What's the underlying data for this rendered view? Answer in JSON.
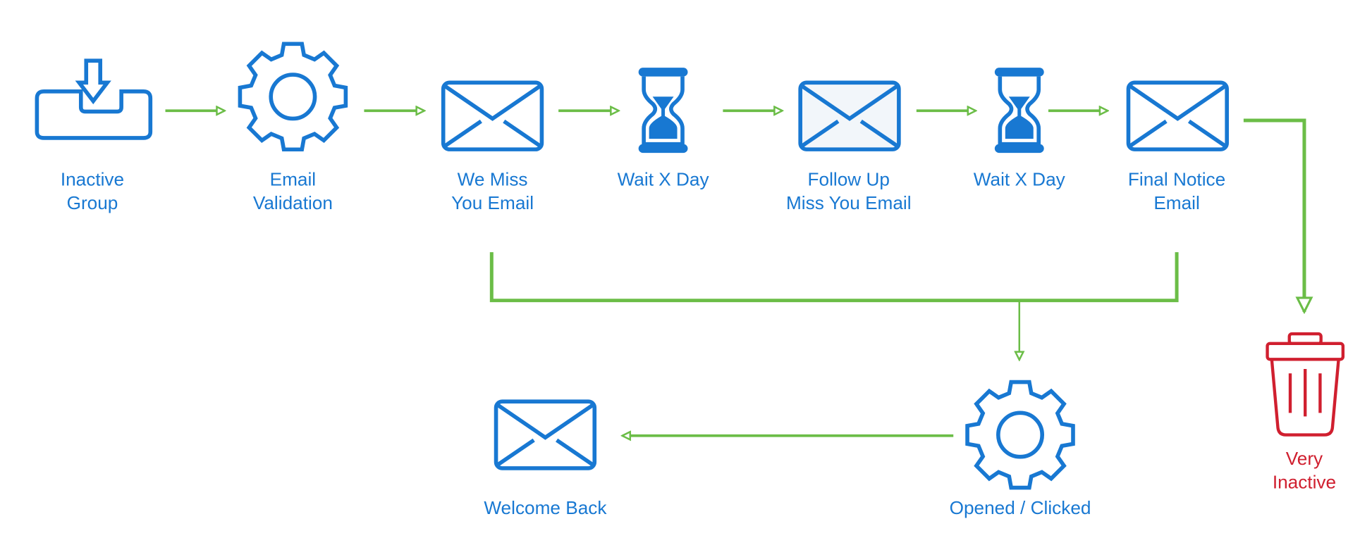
{
  "colors": {
    "icon": "#1878d2",
    "connector": "#6bbd47",
    "danger": "#d01f2f",
    "envelope_fill_highlight": "#f2f6fa"
  },
  "nodes": {
    "inactive_group": {
      "label_1": "Inactive",
      "label_2": "Group",
      "icon": "inbox-download-icon"
    },
    "email_validation": {
      "label_1": "Email",
      "label_2": "Validation",
      "icon": "gear-icon"
    },
    "we_miss_you": {
      "label_1": "We Miss",
      "label_2": "You Email",
      "icon": "envelope-icon"
    },
    "wait_1": {
      "label_1": "Wait X Day",
      "icon": "hourglass-icon"
    },
    "follow_up": {
      "label_1": "Follow Up",
      "label_2": "Miss You Email",
      "icon": "envelope-icon"
    },
    "wait_2": {
      "label_1": "Wait X Day",
      "icon": "hourglass-icon"
    },
    "final_notice": {
      "label_1": "Final Notice",
      "label_2": "Email",
      "icon": "envelope-icon"
    },
    "very_inactive": {
      "label_1": "Very",
      "label_2": "Inactive",
      "icon": "trash-icon"
    },
    "opened_clicked": {
      "label_1": "Opened / Clicked",
      "icon": "gear-icon"
    },
    "welcome_back": {
      "label_1": "Welcome Back",
      "icon": "envelope-icon"
    }
  }
}
